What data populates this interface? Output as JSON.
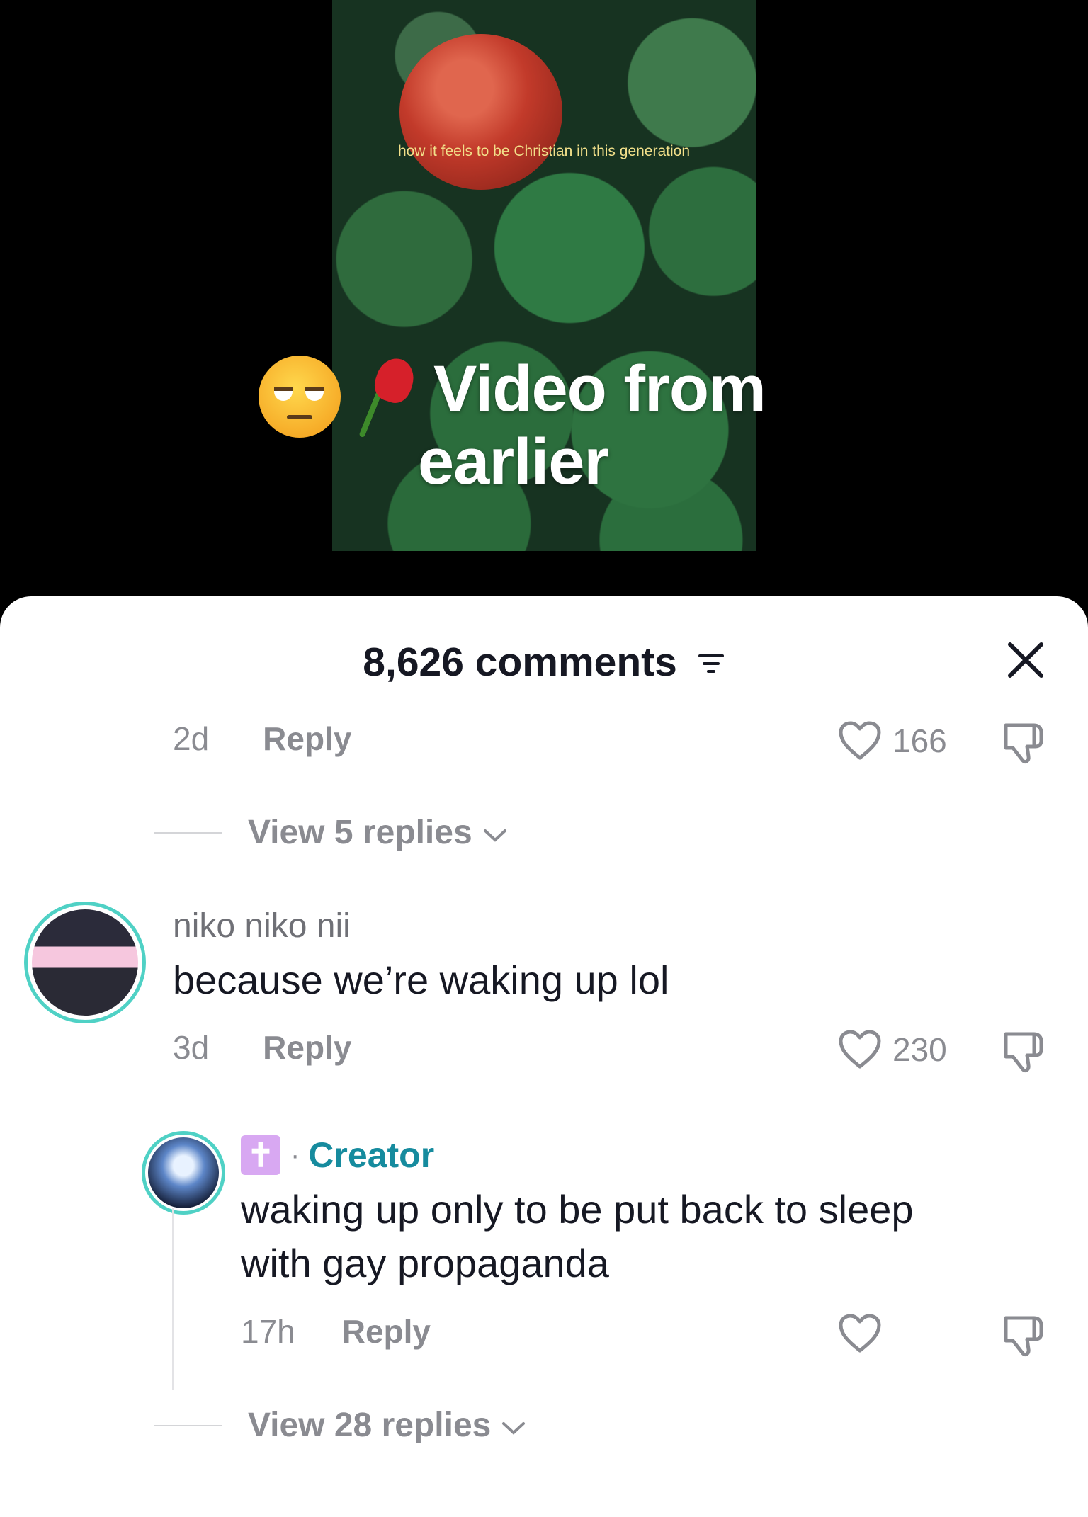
{
  "video": {
    "caption": "how it feels to be Christian in this generation",
    "overlay_line1": "Video from",
    "overlay_line2": "earlier",
    "overlay_emojis": [
      "unamused-face",
      "wilted-rose"
    ]
  },
  "sheet": {
    "title": "8,626 comments",
    "filter_icon": "filter-icon",
    "close_icon": "close-icon"
  },
  "comments": [
    {
      "time": "2d",
      "reply_label": "Reply",
      "likes": "166",
      "view_replies": "View 5 replies"
    },
    {
      "username": "niko niko nii",
      "text": "because we’re waking up lol",
      "time": "3d",
      "reply_label": "Reply",
      "likes": "230"
    }
  ],
  "reply": {
    "badge": "✝",
    "creator_label": "Creator",
    "text_line1": "waking up only to be put back to sleep",
    "text_line2": "with gay propaganda",
    "time": "17h",
    "reply_label": "Reply",
    "view_replies": "View 28 replies"
  },
  "colors": {
    "accent_teal": "#168b9e",
    "avatar_ring": "#4fd1c5",
    "muted": "#8a8b91",
    "text": "#161823"
  }
}
